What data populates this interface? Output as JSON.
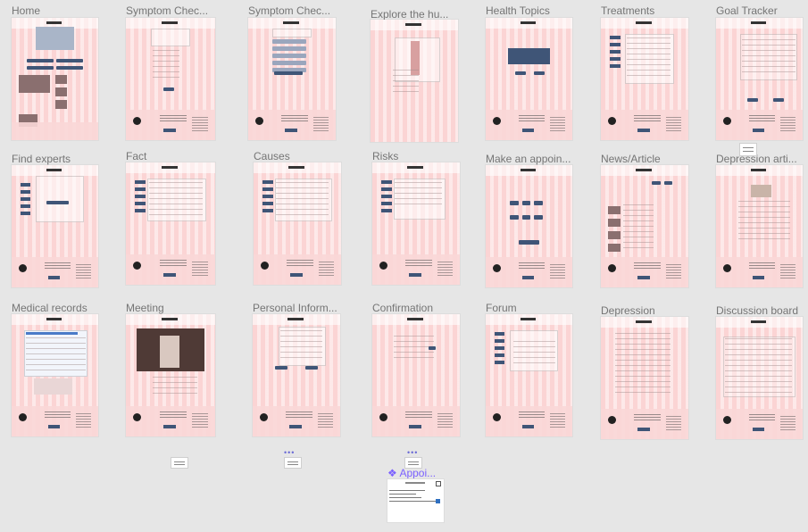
{
  "canvas": {
    "background": "#e6e6e6",
    "frame_color": "#fde3e3",
    "button_color": "#3f5577",
    "component_label_color": "#7b61ff"
  },
  "frames": [
    {
      "label": "Home"
    },
    {
      "label": "Symptom Chec..."
    },
    {
      "label": "Symptom Chec..."
    },
    {
      "label": "Explore the hu..."
    },
    {
      "label": "Health Topics"
    },
    {
      "label": "Treatments"
    },
    {
      "label": "Goal Tracker"
    },
    {
      "label": "Find experts"
    },
    {
      "label": "Fact"
    },
    {
      "label": "Causes"
    },
    {
      "label": "Risks"
    },
    {
      "label": "Make an appoin..."
    },
    {
      "label": "News/Article"
    },
    {
      "label": "Depression arti..."
    },
    {
      "label": "Medical records"
    },
    {
      "label": "Meeting"
    },
    {
      "label": "Personal Inform..."
    },
    {
      "label": "Confirmation"
    },
    {
      "label": "Forum"
    },
    {
      "label": "Depression"
    },
    {
      "label": "Discussion board"
    }
  ],
  "component": {
    "label": "Appoi...",
    "icon": "component-diamond-icon"
  }
}
